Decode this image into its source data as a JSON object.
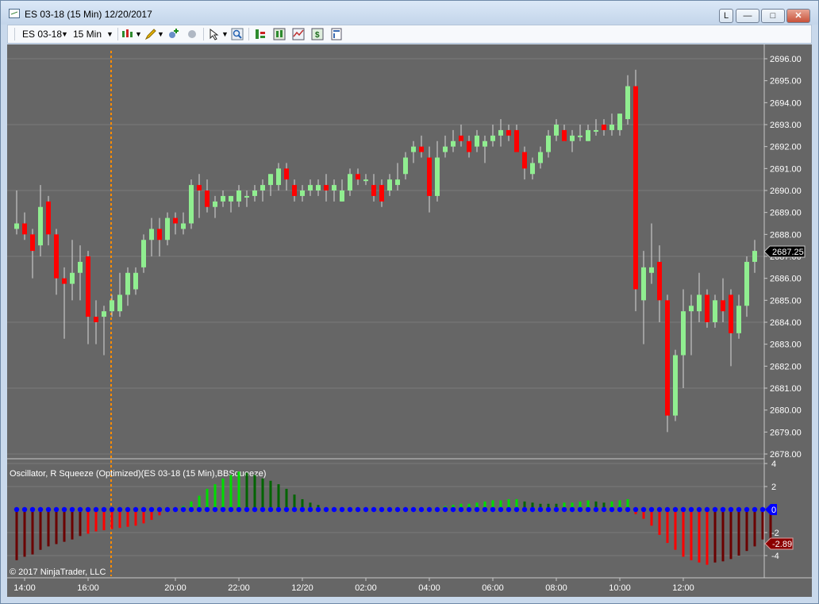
{
  "window": {
    "title": "ES 03-18 (15 Min)  12/20/2017",
    "buttons": {
      "link": "L",
      "minimize": "—",
      "maximize": "□",
      "close": "✕"
    }
  },
  "toolbar": {
    "instrument": "ES 03-18",
    "interval": "15 Min"
  },
  "price_axis": {
    "labels": [
      "2696.00",
      "2695.00",
      "2694.00",
      "2693.00",
      "2692.00",
      "2691.00",
      "2690.00",
      "2689.00",
      "2688.00",
      "2687.00",
      "2686.00",
      "2685.00",
      "2684.00",
      "2683.00",
      "2682.00",
      "2681.00",
      "2680.00",
      "2679.00",
      "2678.00"
    ],
    "last_price": "2687.25"
  },
  "indicator": {
    "label": "Oscillator, R Squeeze (Optimized)(ES 03-18 (15 Min),BBSqueeze)",
    "axis_labels": [
      "4",
      "2",
      "-2",
      "-4"
    ],
    "zero_label": "0",
    "last_value": "-2.89"
  },
  "time_axis": {
    "labels": [
      "14:00",
      "16:00",
      "20:00",
      "22:00",
      "12/20",
      "02:00",
      "04:00",
      "06:00",
      "08:00",
      "10:00",
      "12:00"
    ]
  },
  "copyright": "© 2017 NinjaTrader, LLC",
  "colors": {
    "up": "#90ee90",
    "down": "#ff0000",
    "background": "#666666",
    "dots": "#0000ff",
    "session_line": "#ff8c00"
  },
  "chart_data": [
    {
      "type": "candlestick",
      "title": "ES 03-18 (15 Min)",
      "ylim": [
        2678,
        2696
      ],
      "candles": [
        {
          "o": 2688.25,
          "h": 2690.0,
          "l": 2688.0,
          "c": 2688.5
        },
        {
          "o": 2688.5,
          "h": 2689.0,
          "l": 2687.75,
          "c": 2688.0
        },
        {
          "o": 2688.0,
          "h": 2688.25,
          "l": 2686.0,
          "c": 2687.25
        },
        {
          "o": 2687.5,
          "h": 2690.25,
          "l": 2687.0,
          "c": 2689.25
        },
        {
          "o": 2689.5,
          "h": 2689.75,
          "l": 2687.5,
          "c": 2688.0
        },
        {
          "o": 2688.0,
          "h": 2688.25,
          "l": 2685.25,
          "c": 2686.0
        },
        {
          "o": 2686.0,
          "h": 2686.5,
          "l": 2683.25,
          "c": 2685.75
        },
        {
          "o": 2685.75,
          "h": 2687.75,
          "l": 2685.0,
          "c": 2686.25
        },
        {
          "o": 2686.25,
          "h": 2687.5,
          "l": 2685.0,
          "c": 2686.75
        },
        {
          "o": 2687.0,
          "h": 2687.25,
          "l": 2683.0,
          "c": 2684.25
        },
        {
          "o": 2684.25,
          "h": 2685.0,
          "l": 2683.0,
          "c": 2684.0
        },
        {
          "o": 2684.25,
          "h": 2684.75,
          "l": 2682.5,
          "c": 2684.5
        },
        {
          "o": 2684.5,
          "h": 2685.25,
          "l": 2684.25,
          "c": 2685.0
        },
        {
          "o": 2684.5,
          "h": 2686.25,
          "l": 2684.25,
          "c": 2685.25
        },
        {
          "o": 2685.25,
          "h": 2686.5,
          "l": 2684.75,
          "c": 2686.25
        },
        {
          "o": 2685.5,
          "h": 2686.5,
          "l": 2685.25,
          "c": 2686.25
        },
        {
          "o": 2686.5,
          "h": 2688.0,
          "l": 2686.25,
          "c": 2687.75
        },
        {
          "o": 2687.75,
          "h": 2688.75,
          "l": 2687.0,
          "c": 2688.25
        },
        {
          "o": 2688.25,
          "h": 2688.75,
          "l": 2687.0,
          "c": 2687.75
        },
        {
          "o": 2687.75,
          "h": 2689.0,
          "l": 2687.5,
          "c": 2688.75
        },
        {
          "o": 2688.75,
          "h": 2689.0,
          "l": 2688.0,
          "c": 2688.5
        },
        {
          "o": 2688.25,
          "h": 2689.0,
          "l": 2688.0,
          "c": 2688.5
        },
        {
          "o": 2688.5,
          "h": 2690.5,
          "l": 2688.25,
          "c": 2690.25
        },
        {
          "o": 2690.25,
          "h": 2690.75,
          "l": 2688.75,
          "c": 2690.0
        },
        {
          "o": 2690.0,
          "h": 2690.5,
          "l": 2689.0,
          "c": 2689.25
        },
        {
          "o": 2689.25,
          "h": 2689.75,
          "l": 2688.75,
          "c": 2689.5
        },
        {
          "o": 2689.5,
          "h": 2690.0,
          "l": 2689.25,
          "c": 2689.75
        },
        {
          "o": 2689.5,
          "h": 2689.75,
          "l": 2689.0,
          "c": 2689.75
        },
        {
          "o": 2689.5,
          "h": 2690.25,
          "l": 2689.25,
          "c": 2690.0
        },
        {
          "o": 2689.75,
          "h": 2690.0,
          "l": 2689.25,
          "c": 2689.75
        },
        {
          "o": 2689.75,
          "h": 2690.25,
          "l": 2689.5,
          "c": 2690.0
        },
        {
          "o": 2690.0,
          "h": 2690.5,
          "l": 2689.5,
          "c": 2690.25
        },
        {
          "o": 2690.25,
          "h": 2690.75,
          "l": 2689.75,
          "c": 2690.75
        },
        {
          "o": 2690.25,
          "h": 2691.25,
          "l": 2690.0,
          "c": 2691.0
        },
        {
          "o": 2691.0,
          "h": 2691.25,
          "l": 2690.0,
          "c": 2690.5
        },
        {
          "o": 2690.25,
          "h": 2690.5,
          "l": 2689.5,
          "c": 2689.75
        },
        {
          "o": 2689.75,
          "h": 2690.25,
          "l": 2689.5,
          "c": 2690.0
        },
        {
          "o": 2690.0,
          "h": 2690.5,
          "l": 2689.75,
          "c": 2690.25
        },
        {
          "o": 2690.0,
          "h": 2690.5,
          "l": 2689.75,
          "c": 2690.25
        },
        {
          "o": 2690.25,
          "h": 2690.75,
          "l": 2689.5,
          "c": 2690.0
        },
        {
          "o": 2690.0,
          "h": 2690.5,
          "l": 2689.5,
          "c": 2690.25
        },
        {
          "o": 2689.5,
          "h": 2690.5,
          "l": 2689.5,
          "c": 2690.0
        },
        {
          "o": 2690.0,
          "h": 2691.0,
          "l": 2689.75,
          "c": 2690.75
        },
        {
          "o": 2690.75,
          "h": 2691.0,
          "l": 2690.25,
          "c": 2690.5
        },
        {
          "o": 2690.5,
          "h": 2690.75,
          "l": 2690.25,
          "c": 2690.5
        },
        {
          "o": 2690.25,
          "h": 2690.75,
          "l": 2689.5,
          "c": 2689.75
        },
        {
          "o": 2690.25,
          "h": 2690.5,
          "l": 2689.25,
          "c": 2689.5
        },
        {
          "o": 2690.0,
          "h": 2690.75,
          "l": 2689.75,
          "c": 2690.5
        },
        {
          "o": 2690.25,
          "h": 2691.25,
          "l": 2690.0,
          "c": 2690.5
        },
        {
          "o": 2690.75,
          "h": 2691.75,
          "l": 2690.5,
          "c": 2691.5
        },
        {
          "o": 2691.75,
          "h": 2692.25,
          "l": 2691.25,
          "c": 2692.0
        },
        {
          "o": 2692.0,
          "h": 2692.5,
          "l": 2691.5,
          "c": 2691.75
        },
        {
          "o": 2691.5,
          "h": 2692.0,
          "l": 2689.0,
          "c": 2689.75
        },
        {
          "o": 2689.75,
          "h": 2692.25,
          "l": 2689.5,
          "c": 2691.5
        },
        {
          "o": 2691.75,
          "h": 2692.5,
          "l": 2691.5,
          "c": 2692.0
        },
        {
          "o": 2692.0,
          "h": 2692.75,
          "l": 2691.75,
          "c": 2692.25
        },
        {
          "o": 2692.5,
          "h": 2693.0,
          "l": 2692.0,
          "c": 2692.25
        },
        {
          "o": 2692.25,
          "h": 2692.5,
          "l": 2691.5,
          "c": 2691.75
        },
        {
          "o": 2692.0,
          "h": 2692.75,
          "l": 2691.75,
          "c": 2692.5
        },
        {
          "o": 2692.0,
          "h": 2692.5,
          "l": 2691.25,
          "c": 2692.25
        },
        {
          "o": 2692.25,
          "h": 2693.0,
          "l": 2692.0,
          "c": 2692.5
        },
        {
          "o": 2692.5,
          "h": 2693.25,
          "l": 2692.0,
          "c": 2692.75
        },
        {
          "o": 2692.75,
          "h": 2693.0,
          "l": 2692.25,
          "c": 2692.5
        },
        {
          "o": 2692.75,
          "h": 2693.0,
          "l": 2692.0,
          "c": 2691.75
        },
        {
          "o": 2691.75,
          "h": 2692.0,
          "l": 2690.5,
          "c": 2691.0
        },
        {
          "o": 2690.75,
          "h": 2691.5,
          "l": 2690.5,
          "c": 2691.25
        },
        {
          "o": 2691.25,
          "h": 2692.0,
          "l": 2691.0,
          "c": 2691.75
        },
        {
          "o": 2691.75,
          "h": 2692.75,
          "l": 2691.5,
          "c": 2692.5
        },
        {
          "o": 2692.5,
          "h": 2693.25,
          "l": 2692.25,
          "c": 2693.0
        },
        {
          "o": 2692.75,
          "h": 2693.0,
          "l": 2692.25,
          "c": 2692.25
        },
        {
          "o": 2692.25,
          "h": 2692.75,
          "l": 2691.75,
          "c": 2692.5
        },
        {
          "o": 2692.5,
          "h": 2693.0,
          "l": 2692.25,
          "c": 2692.5
        },
        {
          "o": 2692.25,
          "h": 2693.0,
          "l": 2692.25,
          "c": 2692.75
        },
        {
          "o": 2692.75,
          "h": 2693.25,
          "l": 2692.5,
          "c": 2692.75
        },
        {
          "o": 2693.0,
          "h": 2693.25,
          "l": 2692.5,
          "c": 2692.75
        },
        {
          "o": 2692.75,
          "h": 2693.5,
          "l": 2692.5,
          "c": 2693.0
        },
        {
          "o": 2692.75,
          "h": 2693.5,
          "l": 2692.5,
          "c": 2693.5
        },
        {
          "o": 2693.25,
          "h": 2695.25,
          "l": 2693.0,
          "c": 2694.75
        },
        {
          "o": 2694.75,
          "h": 2695.5,
          "l": 2684.5,
          "c": 2685.5
        },
        {
          "o": 2685.0,
          "h": 2687.25,
          "l": 2683.0,
          "c": 2686.5
        },
        {
          "o": 2686.25,
          "h": 2688.5,
          "l": 2685.75,
          "c": 2686.5
        },
        {
          "o": 2686.75,
          "h": 2687.5,
          "l": 2684.0,
          "c": 2685.0
        },
        {
          "o": 2685.0,
          "h": 2685.25,
          "l": 2679.0,
          "c": 2679.75
        },
        {
          "o": 2679.75,
          "h": 2682.75,
          "l": 2679.5,
          "c": 2682.5
        },
        {
          "o": 2682.5,
          "h": 2685.5,
          "l": 2681.0,
          "c": 2684.5
        },
        {
          "o": 2684.5,
          "h": 2685.25,
          "l": 2682.5,
          "c": 2684.75
        },
        {
          "o": 2684.5,
          "h": 2686.25,
          "l": 2684.0,
          "c": 2685.25
        },
        {
          "o": 2685.25,
          "h": 2685.5,
          "l": 2683.75,
          "c": 2684.0
        },
        {
          "o": 2684.0,
          "h": 2685.25,
          "l": 2683.75,
          "c": 2685.0
        },
        {
          "o": 2685.0,
          "h": 2686.0,
          "l": 2684.0,
          "c": 2684.5
        },
        {
          "o": 2685.25,
          "h": 2685.5,
          "l": 2682.0,
          "c": 2683.5
        },
        {
          "o": 2683.5,
          "h": 2685.25,
          "l": 2683.25,
          "c": 2684.75
        },
        {
          "o": 2684.75,
          "h": 2687.0,
          "l": 2684.25,
          "c": 2686.75
        },
        {
          "o": 2686.75,
          "h": 2687.75,
          "l": 2686.25,
          "c": 2687.25
        }
      ]
    },
    {
      "type": "bar",
      "title": "Oscillator, R Squeeze (Optimized)(ES 03-18 (15 Min),BBSqueeze)",
      "ylim": [
        -5,
        4
      ],
      "values": [
        -4.4,
        -4.1,
        -3.9,
        -3.5,
        -3.2,
        -3.0,
        -2.8,
        -2.6,
        -2.3,
        -2.1,
        -1.9,
        -1.8,
        -1.7,
        -1.6,
        -1.5,
        -1.4,
        -1.2,
        -0.9,
        -0.5,
        -0.1,
        0.1,
        0.3,
        0.7,
        1.2,
        1.8,
        2.2,
        2.7,
        3.0,
        3.3,
        3.2,
        3.0,
        2.7,
        2.5,
        2.2,
        1.8,
        1.3,
        0.9,
        0.6,
        0.4,
        0.2,
        0.1,
        0.0,
        0.0,
        0.0,
        0.0,
        0.0,
        0.0,
        0.0,
        0.0,
        0.0,
        0.0,
        0.0,
        0.1,
        0.2,
        0.3,
        0.4,
        0.5,
        0.5,
        0.6,
        0.7,
        0.8,
        0.8,
        0.9,
        0.9,
        0.7,
        0.6,
        0.5,
        0.5,
        0.5,
        0.6,
        0.6,
        0.7,
        0.8,
        0.7,
        0.6,
        0.7,
        0.8,
        0.9,
        -0.4,
        -0.8,
        -1.4,
        -2.2,
        -2.9,
        -3.5,
        -4.1,
        -4.4,
        -4.6,
        -4.8,
        -4.6,
        -4.5,
        -4.3,
        -4.0,
        -3.6,
        -3.2,
        -2.6,
        -2.89
      ],
      "colors": [
        "#6b0000",
        "#6b0000",
        "#6b0000",
        "#6b0000",
        "#6b0000",
        "#6b0000",
        "#6b0000",
        "#6b0000",
        "#6b0000",
        "#ff0000",
        "#ff0000",
        "#ff0000",
        "#ff0000",
        "#ff0000",
        "#ff0000",
        "#ff0000",
        "#ff0000",
        "#ff0000",
        "#ff0000",
        "#00dd00",
        "#00dd00",
        "#00dd00",
        "#00dd00",
        "#00dd00",
        "#00dd00",
        "#00dd00",
        "#00dd00",
        "#00dd00",
        "#00dd00",
        "#006400",
        "#006400",
        "#006400",
        "#006400",
        "#006400",
        "#006400",
        "#006400",
        "#006400",
        "#006400",
        "#006400",
        "#006400",
        "#006400",
        "#006400",
        "#006400",
        "#006400",
        "#006400",
        "#006400",
        "#006400",
        "#006400",
        "#006400",
        "#006400",
        "#006400",
        "#006400",
        "#00dd00",
        "#00dd00",
        "#00dd00",
        "#00dd00",
        "#00dd00",
        "#00dd00",
        "#00dd00",
        "#00dd00",
        "#00dd00",
        "#00dd00",
        "#00dd00",
        "#00dd00",
        "#006400",
        "#006400",
        "#006400",
        "#006400",
        "#006400",
        "#00dd00",
        "#00dd00",
        "#00dd00",
        "#00dd00",
        "#006400",
        "#006400",
        "#00dd00",
        "#00dd00",
        "#00dd00",
        "#ff0000",
        "#ff0000",
        "#ff0000",
        "#ff0000",
        "#ff0000",
        "#ff0000",
        "#ff0000",
        "#ff0000",
        "#ff0000",
        "#ff0000",
        "#6b0000",
        "#6b0000",
        "#6b0000",
        "#6b0000",
        "#6b0000",
        "#6b0000",
        "#6b0000",
        "#6b0000"
      ]
    }
  ]
}
